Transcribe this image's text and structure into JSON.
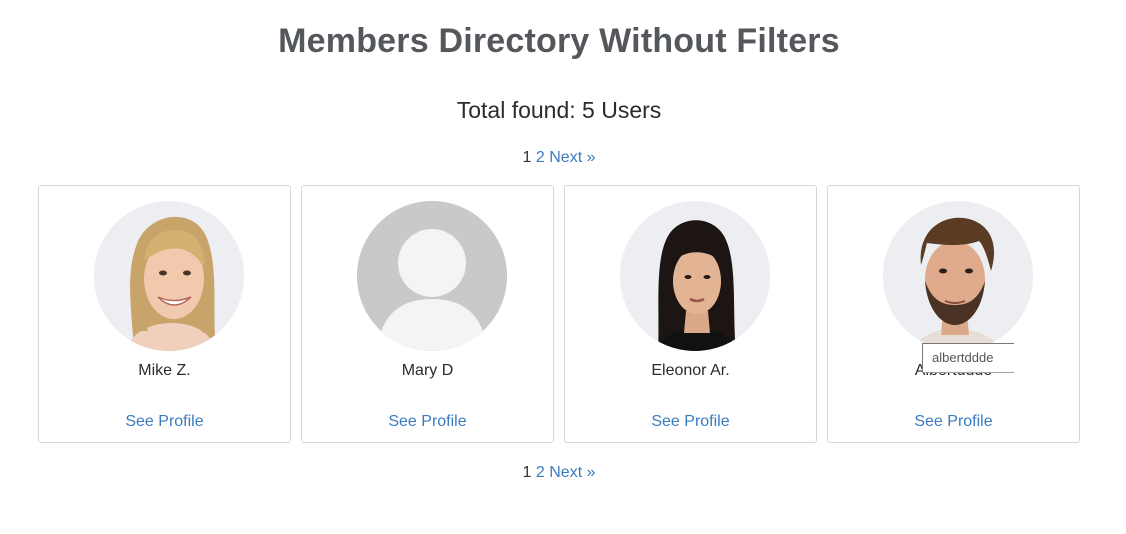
{
  "page": {
    "title": "Members Directory Without Filters",
    "total_found": "Total found: 5 Users"
  },
  "pagination": {
    "current": "1",
    "page2": "2",
    "next": "Next »"
  },
  "members": [
    {
      "name": "Mike Z.",
      "link": "See Profile",
      "avatar": "woman-blonde-photo"
    },
    {
      "name": "Mary D",
      "link": "See Profile",
      "avatar": "default-user-silhouette"
    },
    {
      "name": "Eleonor Ar.",
      "link": "See Profile",
      "avatar": "woman-dark-hair-photo"
    },
    {
      "name": "Albertddde",
      "link": "See Profile",
      "avatar": "man-beard-photo"
    }
  ],
  "tooltip": {
    "text": "albertddde"
  },
  "colors": {
    "link": "#3a7bbf",
    "title": "#54575c",
    "card_border": "#d8d8d8"
  }
}
